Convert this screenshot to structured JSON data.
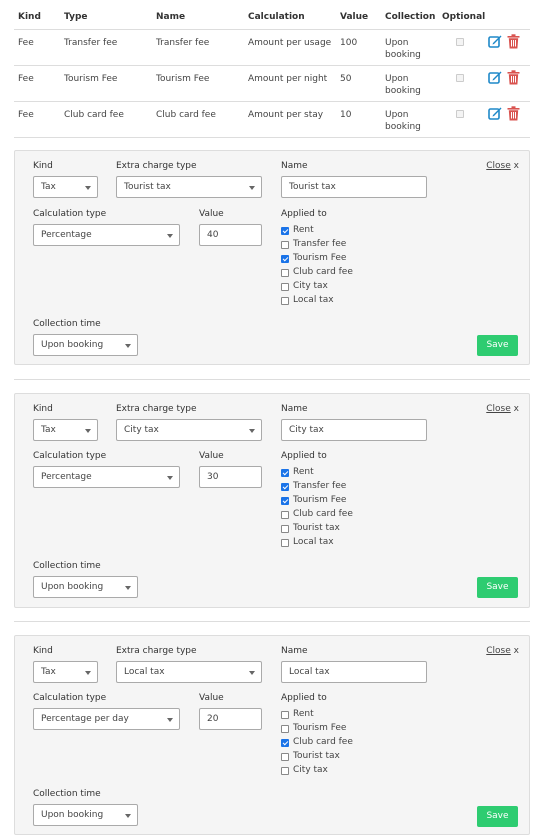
{
  "table": {
    "headers": {
      "kind": "Kind",
      "type": "Type",
      "name": "Name",
      "calculation": "Calculation",
      "value": "Value",
      "collection": "Collection",
      "optional": "Optional"
    },
    "rows": [
      {
        "kind": "Fee",
        "type": "Transfer fee",
        "name": "Transfer fee",
        "calculation": "Amount per usage",
        "value": "100",
        "collection": "Upon booking",
        "optional": false
      },
      {
        "kind": "Fee",
        "type": "Tourism Fee",
        "name": "Tourism Fee",
        "calculation": "Amount per night",
        "value": "50",
        "collection": "Upon booking",
        "optional": false
      },
      {
        "kind": "Fee",
        "type": "Club card fee",
        "name": "Club card fee",
        "calculation": "Amount per stay",
        "value": "10",
        "collection": "Upon booking",
        "optional": false
      }
    ]
  },
  "labels": {
    "kind": "Kind",
    "extra_charge_type": "Extra charge type",
    "name": "Name",
    "calculation_type": "Calculation type",
    "value": "Value",
    "applied_to": "Applied to",
    "collection_time": "Collection time",
    "close": "Close",
    "close_x": "x",
    "save": "Save"
  },
  "forms": [
    {
      "kind": "Tax",
      "extra_charge_type": "Tourist tax",
      "name": "Tourist tax",
      "calculation_type": "Percentage",
      "value": "40",
      "collection_time": "Upon booking",
      "applied_to": [
        {
          "label": "Rent",
          "checked": true
        },
        {
          "label": "Transfer fee",
          "checked": false
        },
        {
          "label": "Tourism Fee",
          "checked": true
        },
        {
          "label": "Club card fee",
          "checked": false
        },
        {
          "label": "City tax",
          "checked": false
        },
        {
          "label": "Local tax",
          "checked": false
        }
      ]
    },
    {
      "kind": "Tax",
      "extra_charge_type": "City tax",
      "name": "City tax",
      "calculation_type": "Percentage",
      "value": "30",
      "collection_time": "Upon booking",
      "applied_to": [
        {
          "label": "Rent",
          "checked": true
        },
        {
          "label": "Transfer fee",
          "checked": true
        },
        {
          "label": "Tourism Fee",
          "checked": true
        },
        {
          "label": "Club card fee",
          "checked": false
        },
        {
          "label": "Tourist tax",
          "checked": false
        },
        {
          "label": "Local tax",
          "checked": false
        }
      ]
    },
    {
      "kind": "Tax",
      "extra_charge_type": "Local tax",
      "name": "Local tax",
      "calculation_type": "Percentage per day",
      "value": "20",
      "collection_time": "Upon booking",
      "applied_to": [
        {
          "label": "Rent",
          "checked": false
        },
        {
          "label": "Tourism Fee",
          "checked": false
        },
        {
          "label": "Club card fee",
          "checked": true
        },
        {
          "label": "Tourist tax",
          "checked": false
        },
        {
          "label": "City tax",
          "checked": false
        }
      ]
    }
  ],
  "colors": {
    "edit_icon": "#1e88c8",
    "delete_icon": "#d9534f",
    "save_button": "#2ecc71",
    "checkbox_checked": "#1a73e8"
  }
}
